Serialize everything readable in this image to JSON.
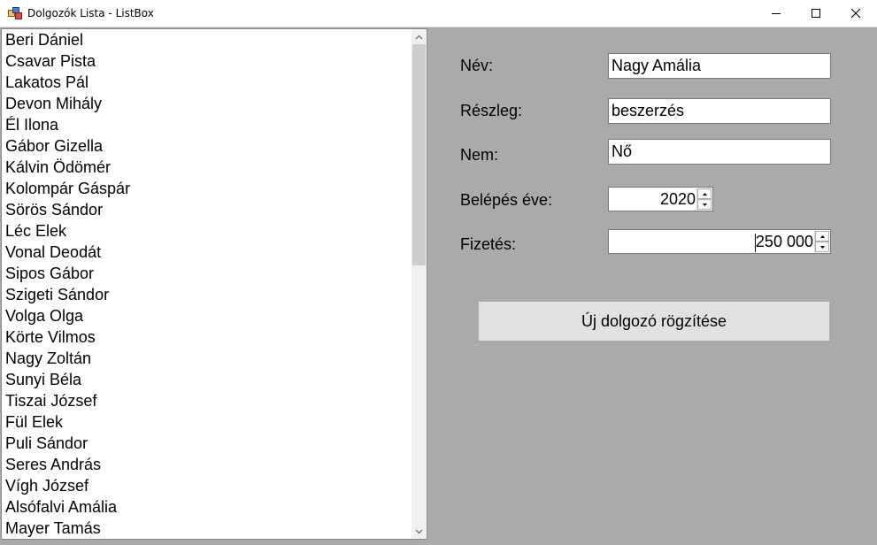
{
  "window": {
    "title": "Dolgozók Lista - ListBox"
  },
  "employees": [
    "Beri Dániel",
    "Csavar Pista",
    "Lakatos Pál",
    "Devon Mihály",
    "Él Ilona",
    "Gábor Gizella",
    "Kálvin Ödömér",
    "Kolompár Gáspár",
    "Sörös Sándor",
    "Léc Elek",
    "Vonal Deodát",
    "Sipos Gábor",
    "Szigeti Sándor",
    "Volga Olga",
    "Körte Vilmos",
    "Nagy Zoltán",
    "Sunyi Béla",
    "Tiszai József",
    "Fül Elek",
    "Puli Sándor",
    "Seres András",
    "Vígh József",
    "Alsófalvi Amália",
    "Mayer Tamás"
  ],
  "form": {
    "name_label": "Név:",
    "name_value": "Nagy Amália",
    "department_label": "Részleg:",
    "department_value": "beszerzés",
    "gender_label": "Nem:",
    "gender_value": "Nő",
    "entry_year_label": "Belépés éve:",
    "entry_year_value": "2020",
    "salary_label": "Fizetés:",
    "salary_value": "250 000",
    "submit_label": "Új dolgozó rögzítése"
  },
  "icons": {
    "app": "app-icon",
    "minimize": "minimize-icon",
    "maximize": "maximize-icon",
    "close": "close-icon"
  },
  "colors": {
    "panel_background": "#aaaaaa",
    "button_background": "#e1e1e1"
  }
}
